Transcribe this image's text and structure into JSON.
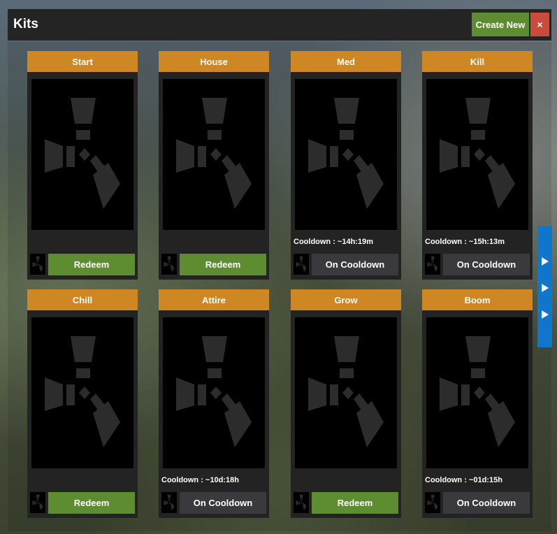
{
  "window": {
    "title": "Kits",
    "create_label": "Create New",
    "close_label": "×"
  },
  "colors": {
    "header": "#ce8723",
    "redeem": "#5e8c31",
    "cooldown": "#3a3a3e",
    "close": "#cc4a3a",
    "pager": "#1076cc"
  },
  "icons": {
    "kit_image": "rust-logo-icon",
    "mini": "rust-logo-icon",
    "pager": "play-arrow-icon"
  },
  "kits": [
    {
      "name": "Start",
      "cooldown": "",
      "action": "Redeem",
      "state": "redeem"
    },
    {
      "name": "House",
      "cooldown": "",
      "action": "Redeem",
      "state": "redeem"
    },
    {
      "name": "Med",
      "cooldown": "Cooldown : ~14h:19m",
      "action": "On Cooldown",
      "state": "cooldown"
    },
    {
      "name": "Kill",
      "cooldown": "Cooldown : ~15h:13m",
      "action": "On Cooldown",
      "state": "cooldown"
    },
    {
      "name": "Chill",
      "cooldown": "",
      "action": "Redeem",
      "state": "redeem"
    },
    {
      "name": "Attire",
      "cooldown": "Cooldown : ~10d:18h",
      "action": "On Cooldown",
      "state": "cooldown"
    },
    {
      "name": "Grow",
      "cooldown": "",
      "action": "Redeem",
      "state": "redeem"
    },
    {
      "name": "Boom",
      "cooldown": "Cooldown : ~01d:15h",
      "action": "On Cooldown",
      "state": "cooldown"
    }
  ]
}
